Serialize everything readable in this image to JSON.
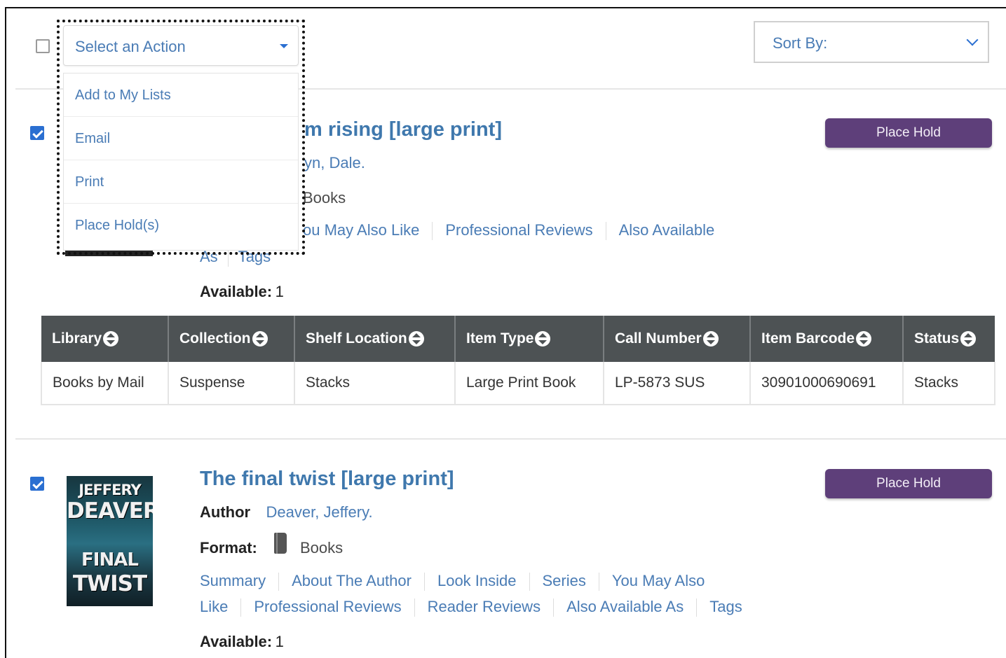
{
  "toolbar": {
    "select_all_checked": false,
    "action_select_label": "Select an Action",
    "action_menu": [
      "Add to My Lists",
      "Email",
      "Print",
      "Place Hold(s)"
    ],
    "sort_label": "Sort By:"
  },
  "result1": {
    "checked": true,
    "title_visible": "m rising [large print]",
    "author_visible": "yn, Dale.",
    "format_visible": "Books",
    "links_visible_line1": [
      "ou May Also Like",
      "Professional Reviews",
      "Also Available"
    ],
    "links_visible_line2": [
      "As",
      "Tags"
    ],
    "available_label": "Available:",
    "available_count": "1",
    "place_hold_label": "Place Hold"
  },
  "table": {
    "headers": [
      "Library",
      "Collection",
      "Shelf Location",
      "Item Type",
      "Call Number",
      "Item Barcode",
      "Status"
    ],
    "rows": [
      [
        "Books by Mail",
        "Suspense",
        "Stacks",
        "Large Print Book",
        "LP-5873 SUS",
        "30901000690691",
        "Stacks"
      ]
    ]
  },
  "result2": {
    "checked": true,
    "title": "The final twist [large print]",
    "author_label": "Author",
    "author": "Deaver, Jeffery.",
    "format_label": "Format:",
    "format": "Books",
    "format_icon": "book-icon",
    "links_line1": [
      "Summary",
      "About The Author",
      "Look Inside",
      "Series",
      "You May Also"
    ],
    "links_line2": [
      "Like",
      "Professional Reviews",
      "Reader Reviews",
      "Also Available As",
      "Tags"
    ],
    "available_label": "Available:",
    "available_count": "1",
    "place_hold_label": "Place Hold",
    "cover_text": [
      "JEFFERY",
      "DEAVER",
      "FINAL",
      "TWIST"
    ]
  },
  "colors": {
    "link": "#4a7cb5",
    "title": "#3f78ad",
    "place_hold_bg": "#5e3f7a",
    "table_header_bg": "#4d5254",
    "checkbox_checked": "#2a6fd1"
  }
}
